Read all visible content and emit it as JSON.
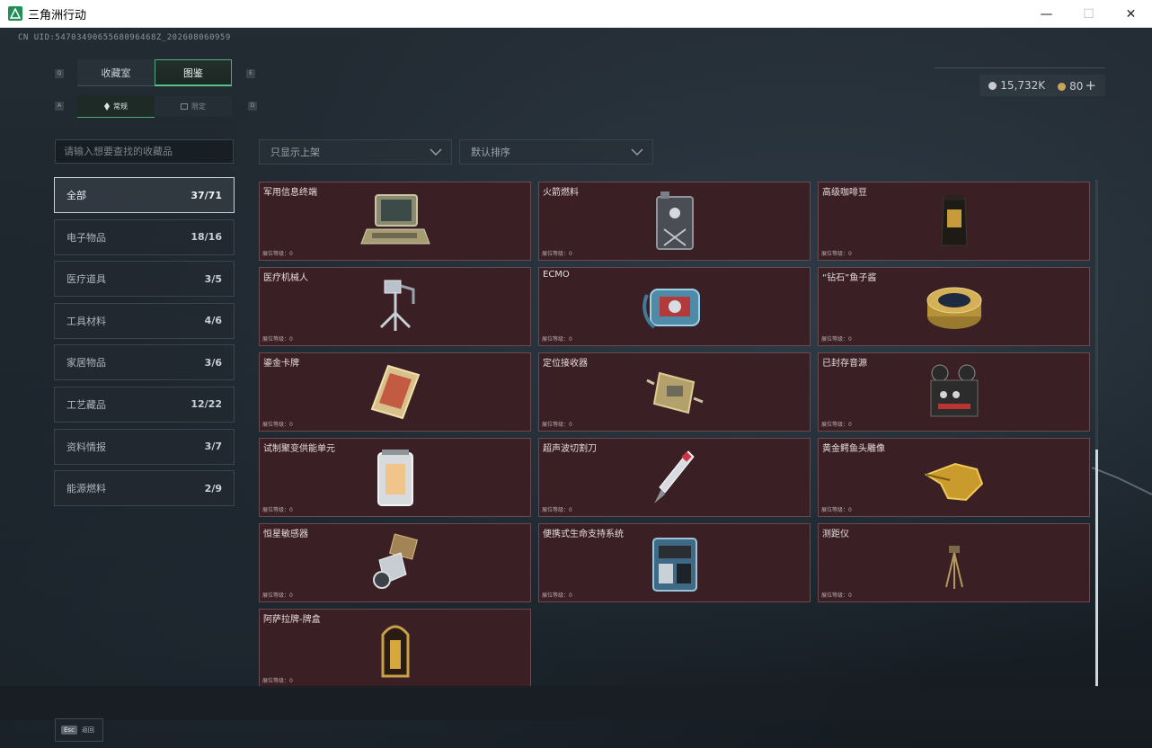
{
  "window": {
    "title": "三角洲行动",
    "controls": [
      "—",
      "☐",
      "✕"
    ]
  },
  "uid": "CN UID:5470349065568096468Z_202608060959",
  "currency": {
    "coins": "15,732K",
    "tickets": "80",
    "add_label": "+"
  },
  "main_tabs": [
    {
      "label": "收藏室",
      "active": false
    },
    {
      "label": "图鉴",
      "active": true
    }
  ],
  "main_tab_keys": {
    "left": "Q",
    "right": "E"
  },
  "sub_tabs": [
    {
      "label": "常规",
      "active": true
    },
    {
      "label": "限定",
      "active": false
    }
  ],
  "sub_tab_keys": {
    "left": "A",
    "right": "D"
  },
  "search": {
    "placeholder": "请输入想要查找的收藏品",
    "value": ""
  },
  "filters": {
    "listing": "只显示上架",
    "sort": "默认排序"
  },
  "categories": [
    {
      "label": "全部",
      "count": "37/71",
      "active": true
    },
    {
      "label": "电子物品",
      "count": "18/16",
      "active": false
    },
    {
      "label": "医疗道具",
      "count": "3/5",
      "active": false
    },
    {
      "label": "工具材料",
      "count": "4/6",
      "active": false
    },
    {
      "label": "家居物品",
      "count": "3/6",
      "active": false
    },
    {
      "label": "工艺藏品",
      "count": "12/22",
      "active": false
    },
    {
      "label": "资料情报",
      "count": "3/7",
      "active": false
    },
    {
      "label": "能源燃料",
      "count": "2/9",
      "active": false
    }
  ],
  "items": [
    {
      "name": "军用信息终端",
      "level": "展位等级：0",
      "icon": "terminal-icon"
    },
    {
      "name": "火箭燃料",
      "level": "展位等级：0",
      "icon": "fuel-can-icon"
    },
    {
      "name": "高级咖啡豆",
      "level": "展位等级：0",
      "icon": "coffee-bag-icon"
    },
    {
      "name": "医疗机械人",
      "level": "展位等级：0",
      "icon": "medical-robot-icon"
    },
    {
      "name": "ECMO",
      "level": "展位等级：0",
      "icon": "ecmo-icon"
    },
    {
      "name": "“钻石”鱼子酱",
      "level": "展位等级：0",
      "icon": "caviar-tin-icon"
    },
    {
      "name": "鎏金卡牌",
      "level": "展位等级：0",
      "icon": "gold-card-icon"
    },
    {
      "name": "定位接收器",
      "level": "展位等级：0",
      "icon": "receiver-icon"
    },
    {
      "name": "已封存音源",
      "level": "展位等级：0",
      "icon": "tape-recorder-icon"
    },
    {
      "name": "试制聚变供能单元",
      "level": "展位等级：0",
      "icon": "fusion-cell-icon"
    },
    {
      "name": "超声波切割刀",
      "level": "展位等级：0",
      "icon": "ultrasonic-knife-icon"
    },
    {
      "name": "黄金鳄鱼头雕像",
      "level": "展位等级：0",
      "icon": "gold-crocodile-icon"
    },
    {
      "name": "恒星敏感器",
      "level": "展位等级：0",
      "icon": "star-sensor-icon"
    },
    {
      "name": "便携式生命支持系统",
      "level": "展位等级：0",
      "icon": "life-support-icon"
    },
    {
      "name": "测距仪",
      "level": "展位等级：0",
      "icon": "rangefinder-icon"
    },
    {
      "name": "阿萨拉牌-牌盒",
      "level": "展位等级：0",
      "icon": "card-box-icon"
    }
  ],
  "back": {
    "key": "Esc",
    "label": "返回"
  },
  "colors": {
    "card_bg": "#3a1f25",
    "accent": "#4fa87c"
  }
}
